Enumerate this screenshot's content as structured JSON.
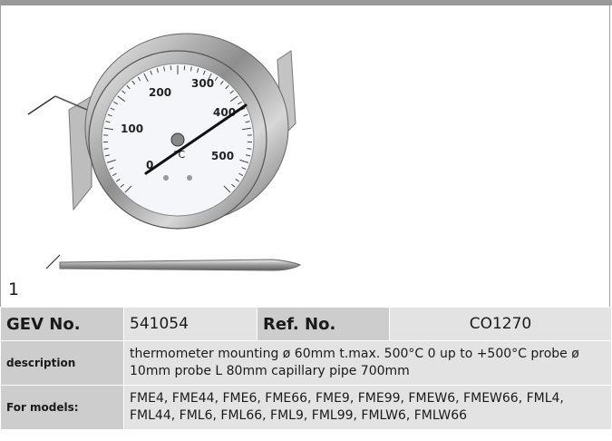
{
  "figure": {
    "number": "1",
    "gauge": {
      "scale_labels": [
        "0",
        "100",
        "200",
        "300",
        "400",
        "500"
      ],
      "unit": "°C",
      "icons": [
        "thermometer-dial-icon",
        "temperature-probe-icon"
      ]
    }
  },
  "spec": {
    "gev_label": "GEV No.",
    "gev_value": "541054",
    "ref_label": "Ref. No.",
    "ref_value": "CO1270",
    "description_label": "description",
    "description_value": "thermometer  mounting ø 60mm t.max. 500°C 0 up to +500°C probe ø 10mm probe L 80mm capillary pipe 700mm",
    "models_label": "For models:",
    "models_value": "FME4, FME44, FME6, FME66, FME9, FME99, FMEW6, FMEW66, FML4, FML44, FML6, FML66, FML9, FML99, FMLW6, FMLW66"
  },
  "colors": {
    "label_bg": "#cdcdcd",
    "value_bg": "#e3e3e3",
    "top_bar": "#999999"
  }
}
